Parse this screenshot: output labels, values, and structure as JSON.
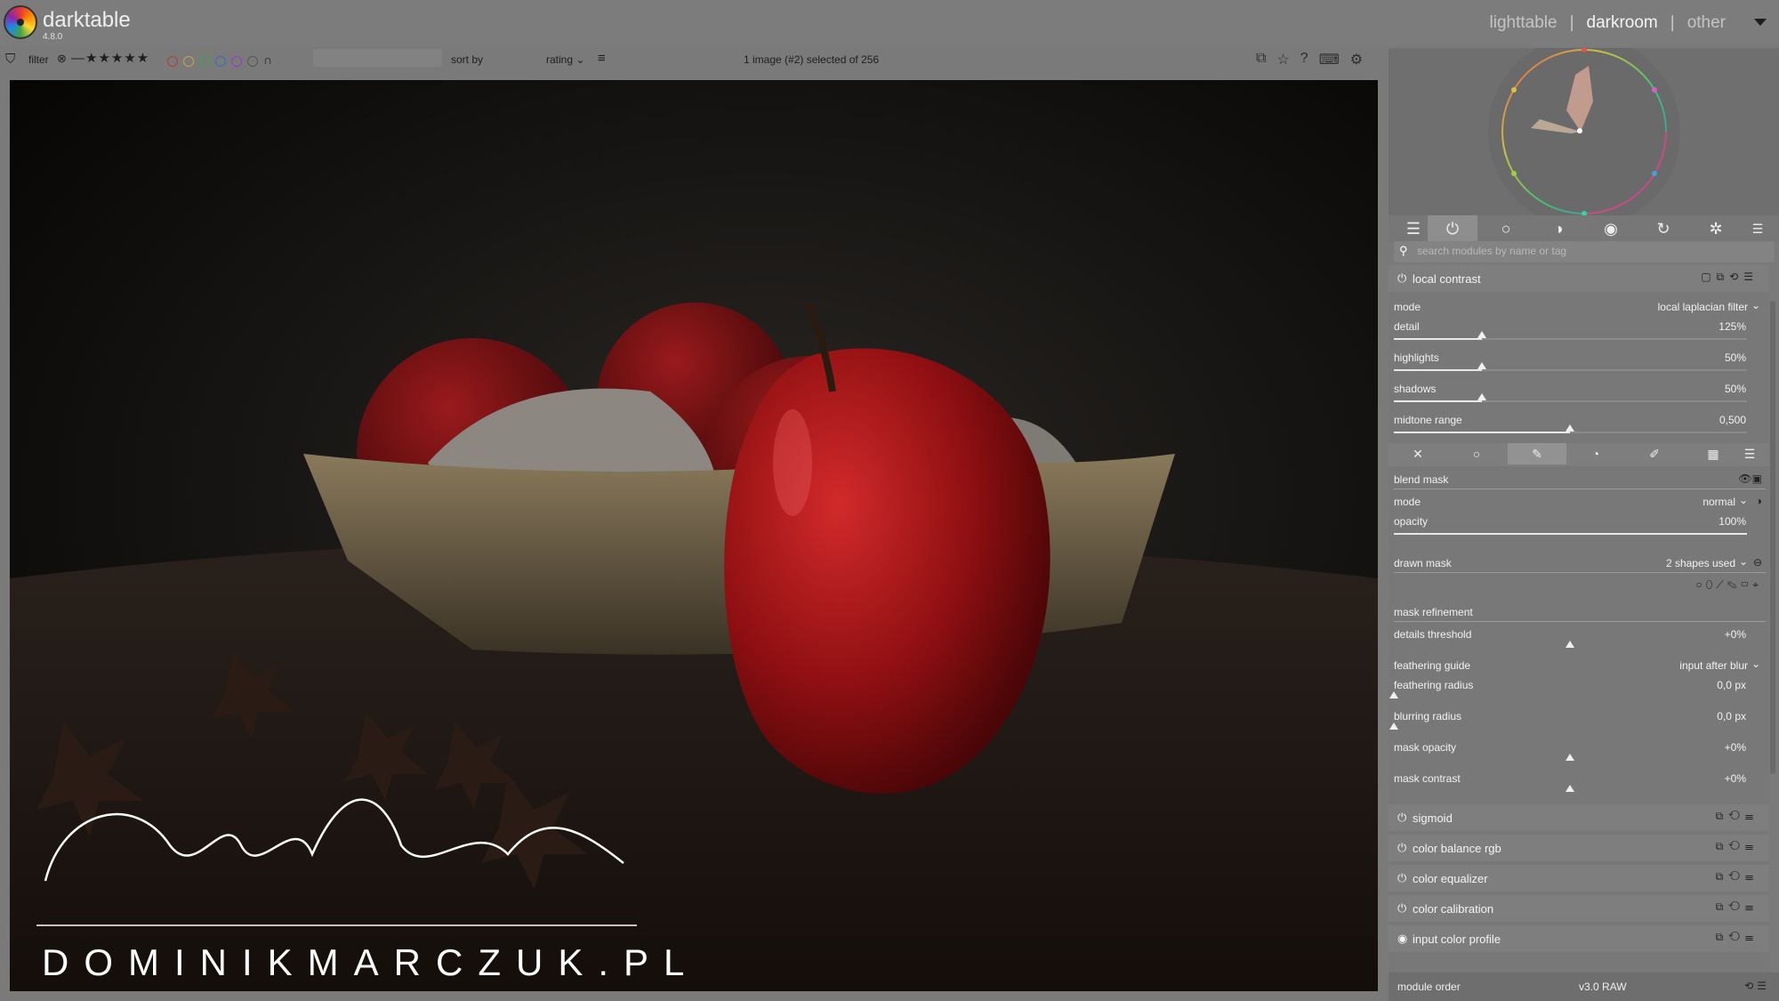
{
  "app": {
    "name": "darktable",
    "version": "4.8.0"
  },
  "views": {
    "lighttable": "lighttable",
    "darkroom": "darkroom",
    "other": "other",
    "separator": "|"
  },
  "filterbar": {
    "filter_label": "filter",
    "stars": "—★★★★★",
    "sort_by_label": "sort by",
    "sort_value": "rating",
    "status": "1 image (#2) selected of 256"
  },
  "color_labels": [
    "#c03a3a",
    "#c8a23a",
    "#3aa84a",
    "#3a6ac8",
    "#9a3ac8"
  ],
  "module_tabs": [
    "quick-access",
    "active",
    "base",
    "tone",
    "color",
    "correct",
    "effect"
  ],
  "module_search": {
    "placeholder": "search modules by name or tag"
  },
  "local_contrast": {
    "title": "local contrast",
    "mode_label": "mode",
    "mode_value": "local laplacian filter",
    "detail_label": "detail",
    "detail_value": "125%",
    "highlights_label": "highlights",
    "highlights_value": "50%",
    "shadows_label": "shadows",
    "shadows_value": "50%",
    "midtone_label": "midtone range",
    "midtone_value": "0,500"
  },
  "blend": {
    "header": "blend mask",
    "mode_label": "mode",
    "mode_value": "normal",
    "opacity_label": "opacity",
    "opacity_value": "100%",
    "drawn_mask_label": "drawn mask",
    "drawn_mask_value": "2 shapes used",
    "refinement_label": "mask refinement",
    "details_threshold_label": "details threshold",
    "details_threshold_value": "+0%",
    "feathering_guide_label": "feathering guide",
    "feathering_guide_value": "input after blur",
    "feathering_radius_label": "feathering radius",
    "feathering_radius_value": "0,0 px",
    "blurring_radius_label": "blurring radius",
    "blurring_radius_value": "0,0 px",
    "mask_opacity_label": "mask opacity",
    "mask_opacity_value": "+0%",
    "mask_contrast_label": "mask contrast",
    "mask_contrast_value": "+0%"
  },
  "modules": [
    {
      "name": "sigmoid"
    },
    {
      "name": "color balance rgb"
    },
    {
      "name": "color equalizer"
    },
    {
      "name": "color calibration"
    },
    {
      "name": "input color profile"
    }
  ],
  "bottom": {
    "module_order_label": "module order",
    "module_order_value": "v3.0 RAW"
  },
  "watermark": {
    "signature": "DominikMarczuk",
    "url": "DOMINIKMARCZUK.PL"
  }
}
